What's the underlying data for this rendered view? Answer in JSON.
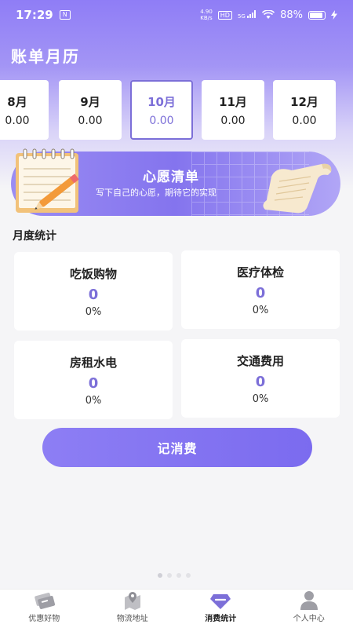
{
  "status_bar": {
    "time": "17:29",
    "left_badge": "N",
    "net_speed_value": "4.90",
    "net_speed_unit": "KB/s",
    "hd": "HD",
    "network": "5G",
    "battery": "88%"
  },
  "page_title": "账单月历",
  "months": [
    {
      "label": "8月",
      "amount": "0.00",
      "selected": false
    },
    {
      "label": "9月",
      "amount": "0.00",
      "selected": false
    },
    {
      "label": "10月",
      "amount": "0.00",
      "selected": true
    },
    {
      "label": "11月",
      "amount": "0.00",
      "selected": false
    },
    {
      "label": "12月",
      "amount": "0.00",
      "selected": false
    }
  ],
  "wish_banner": {
    "title": "心愿清单",
    "subtitle": "写下自己的心愿，期待它的实现"
  },
  "monthly_stats": {
    "title": "月度统计",
    "items": [
      {
        "label": "吃饭购物",
        "value": "0",
        "percent": "0%"
      },
      {
        "label": "医疗体检",
        "value": "0",
        "percent": "0%"
      },
      {
        "label": "房租水电",
        "value": "0",
        "percent": "0%"
      },
      {
        "label": "交通费用",
        "value": "0",
        "percent": "0%"
      }
    ]
  },
  "add_expense_label": "记消费",
  "tabs": [
    {
      "label": "优惠好物",
      "icon": "coupon-icon",
      "active": false
    },
    {
      "label": "物流地址",
      "icon": "map-pin-icon",
      "active": false
    },
    {
      "label": "消费统计",
      "icon": "diamond-icon",
      "active": true
    },
    {
      "label": "个人中心",
      "icon": "user-icon",
      "active": false
    }
  ],
  "colors": {
    "accent": "#7c6fd8",
    "header_gradient_top": "#8f7df6",
    "background": "#f5f5f7"
  }
}
